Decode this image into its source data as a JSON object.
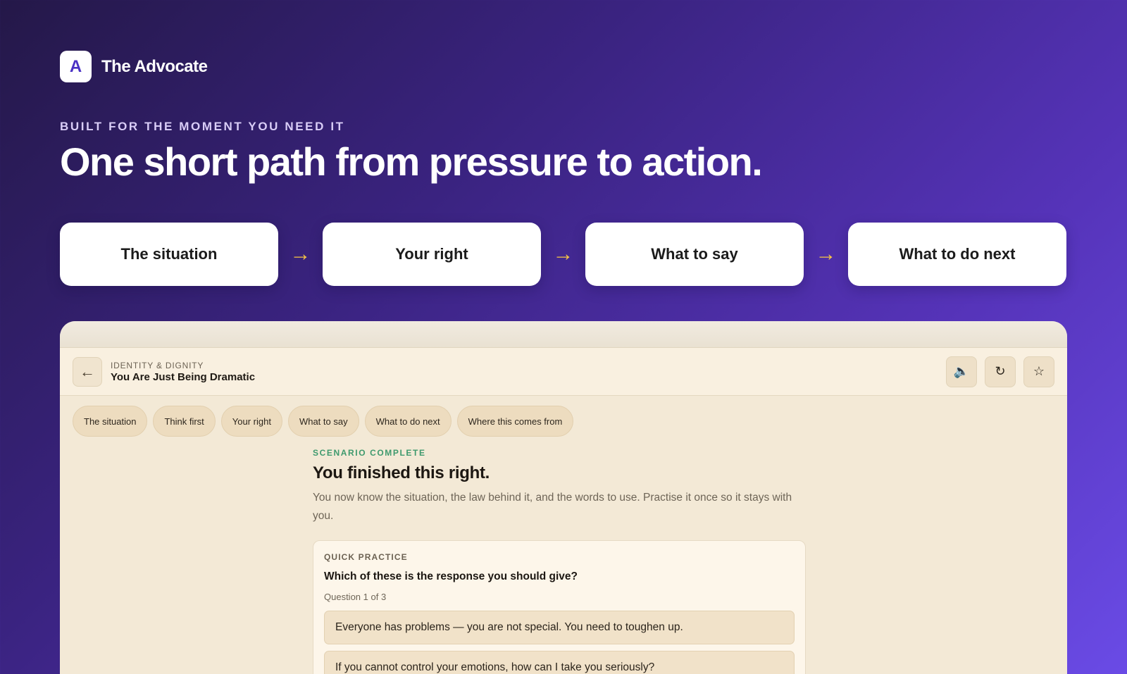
{
  "brand": {
    "logo_letter": "A",
    "name": "The Advocate"
  },
  "hero": {
    "eyebrow": "BUILT FOR THE MOMENT YOU NEED IT",
    "headline": "One short path from pressure to action."
  },
  "steps": [
    {
      "label": "The situation"
    },
    {
      "label": "Your right"
    },
    {
      "label": "What to say"
    },
    {
      "label": "What to do next"
    }
  ],
  "step_arrow": "→",
  "colors": {
    "accent": "#f6c445",
    "brand_purple": "#4a31c4",
    "success": "#3f9a6e"
  },
  "app": {
    "header": {
      "back_icon": "arrow-left-icon",
      "back_glyph": "←",
      "category": "IDENTITY & DIGNITY",
      "title": "You Are Just Being Dramatic",
      "actions": [
        {
          "icon": "speaker-icon",
          "glyph": "🔈"
        },
        {
          "icon": "replay-icon",
          "glyph": "↻"
        },
        {
          "icon": "star-icon",
          "glyph": "☆"
        }
      ]
    },
    "tabs": [
      "The situation",
      "Think first",
      "Your right",
      "What to say",
      "What to do next",
      "Where this comes from"
    ],
    "completion": {
      "label": "SCENARIO COMPLETE",
      "title": "You finished this right.",
      "description": "You now know the situation, the law behind it, and the words to use. Practise it once so it stays with you."
    },
    "practice": {
      "label": "QUICK PRACTICE",
      "question": "Which of these is the response you should give?",
      "counter": "Question 1 of 3",
      "options": [
        "Everyone has problems — you are not special. You need to toughen up.",
        "If you cannot control your emotions, how can I take you seriously?"
      ]
    }
  }
}
